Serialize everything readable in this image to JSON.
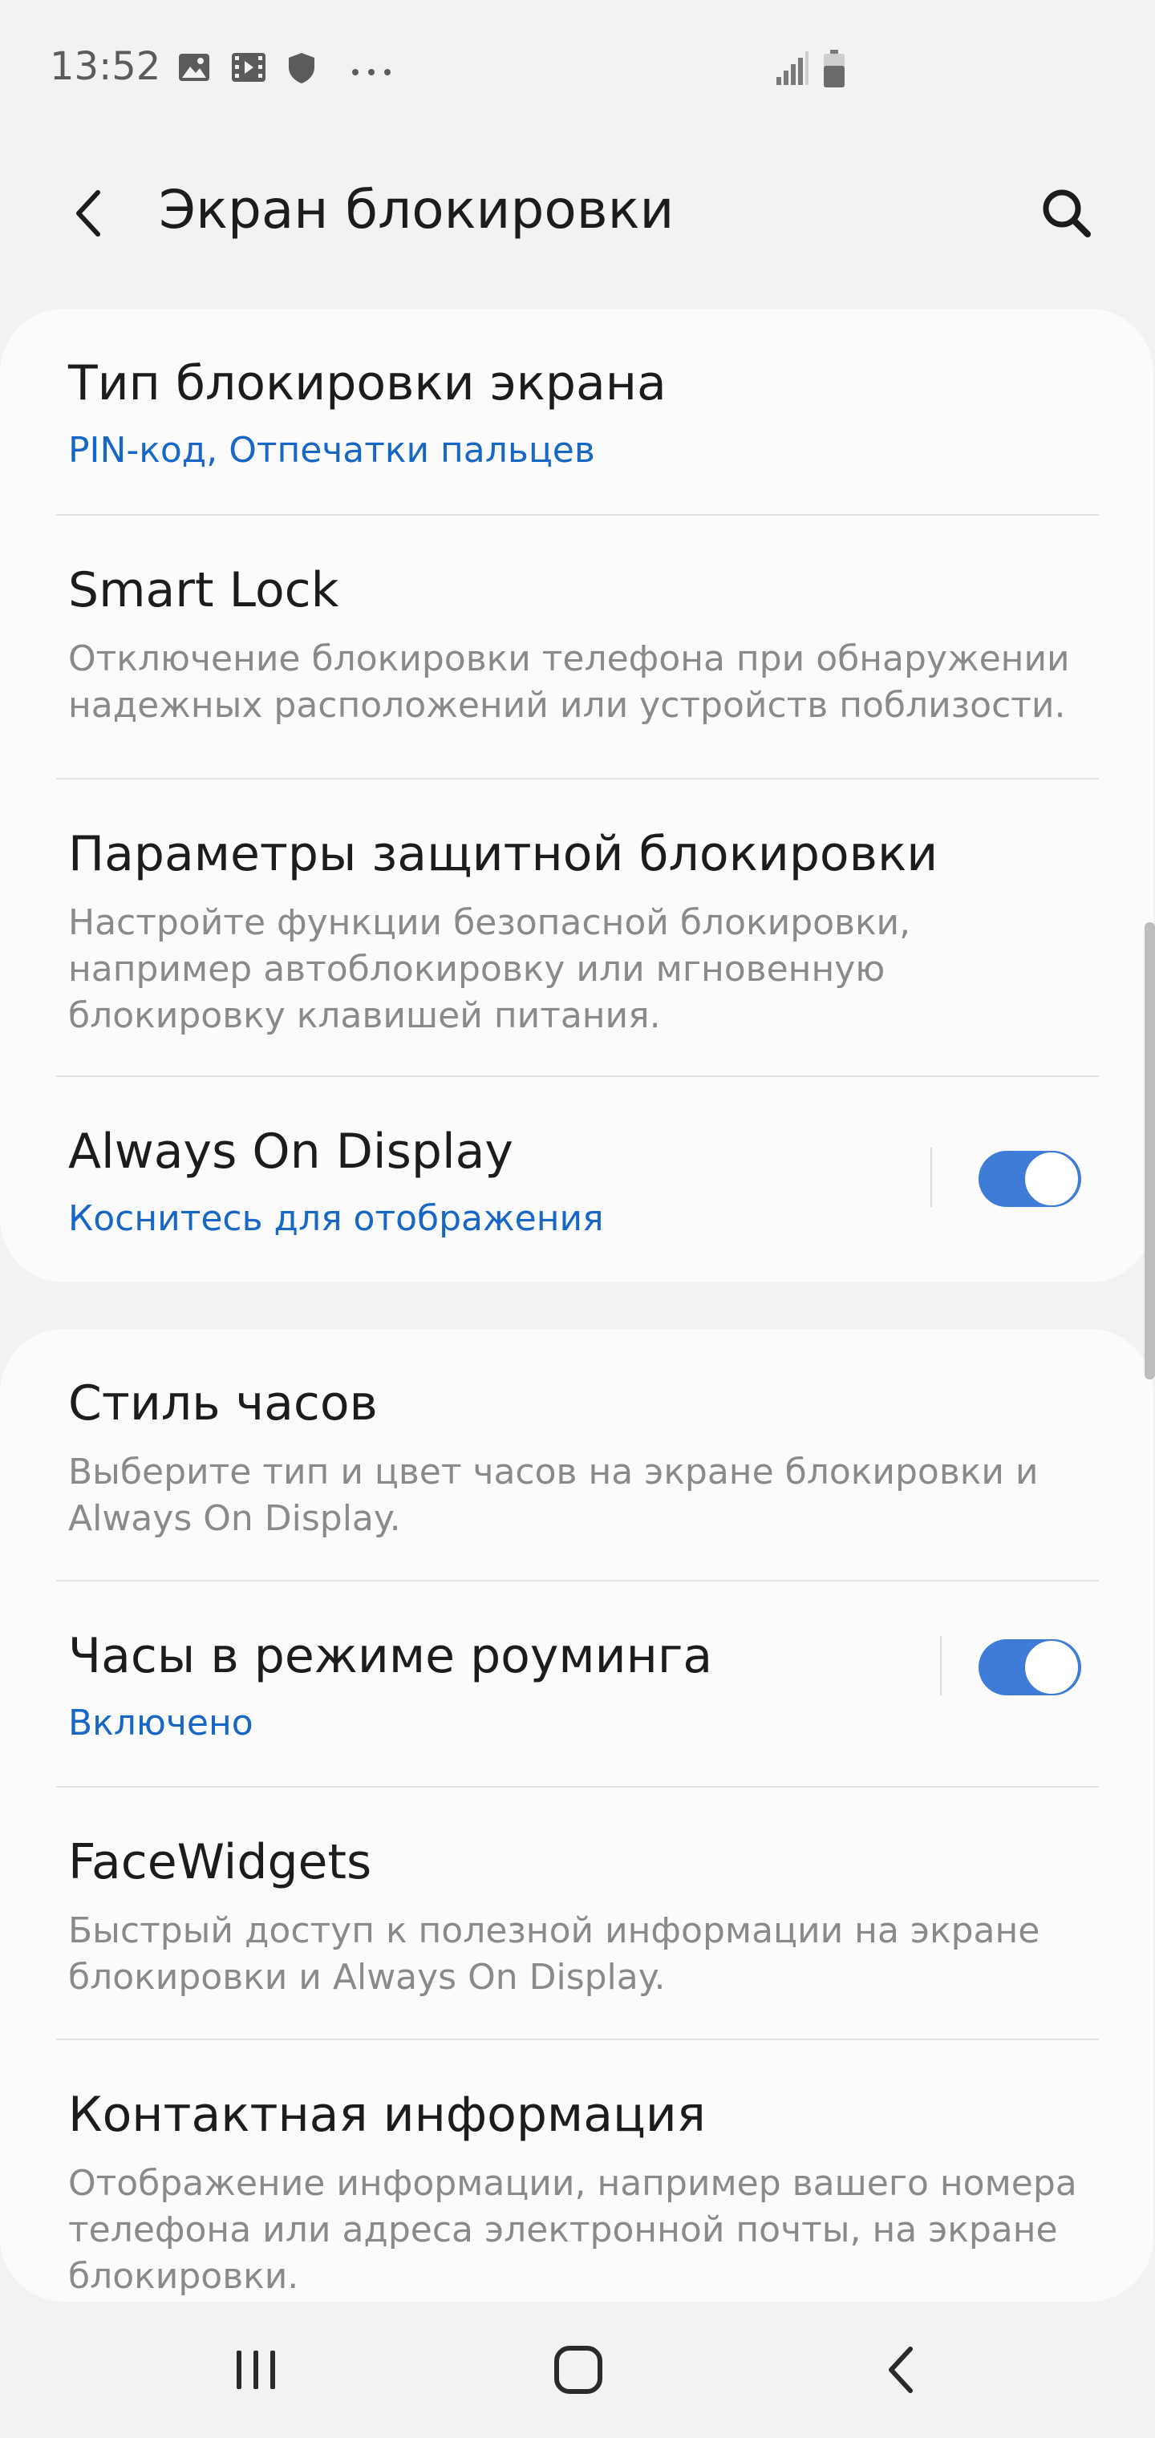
{
  "status_bar": {
    "time": "13:52",
    "icons": [
      "image-icon",
      "video-icon",
      "shield-icon",
      "more-dots-icon"
    ],
    "right_icons": [
      "signal-icon",
      "battery-icon"
    ]
  },
  "app_bar": {
    "title": "Экран блокировки",
    "back_icon": "chevron-left-icon",
    "search_icon": "search-icon"
  },
  "card_1": {
    "items": [
      {
        "title": "Тип блокировки экрана",
        "subtitle": "PIN-код, Отпечатки пальцев"
      },
      {
        "title": "Smart Lock",
        "subtitle": "Отключение блокировки телефона при обнаружении\nнадежных расположений или устройств поблизости."
      },
      {
        "title": "Параметры защитной блокировки",
        "subtitle": "Настройте функции безопасной блокировки,\nнапример автоблокировку или мгновенную\nблокировку клавишей питания."
      },
      {
        "title": "Always On Display",
        "subtitle": "Коснитесь для отображения",
        "toggle_on": true
      }
    ]
  },
  "card_2": {
    "items": [
      {
        "title": "Стиль часов",
        "subtitle": "Выберите тип и цвет часов на экране блокировки и\nAlways On Display."
      },
      {
        "title": "Часы в режиме роуминга",
        "subtitle": "Включено",
        "toggle_on": true
      },
      {
        "title": "FaceWidgets",
        "subtitle": "Быстрый доступ к полезной информации на экране\nблокировки и Always On Display."
      },
      {
        "title": "Контактная информация",
        "subtitle": "Отображение информации, например вашего номера\nтелефона или адреса электронной почты, на экране\nблокировки."
      }
    ]
  },
  "nav_bar": {
    "icons": [
      "recent-apps-icon",
      "home-icon",
      "back-icon"
    ]
  },
  "colors": {
    "accent_blue": "#1667c6",
    "toggle_blue": "#3e7cd8",
    "background": "#f2f2f2",
    "card": "#fbfbfb"
  }
}
